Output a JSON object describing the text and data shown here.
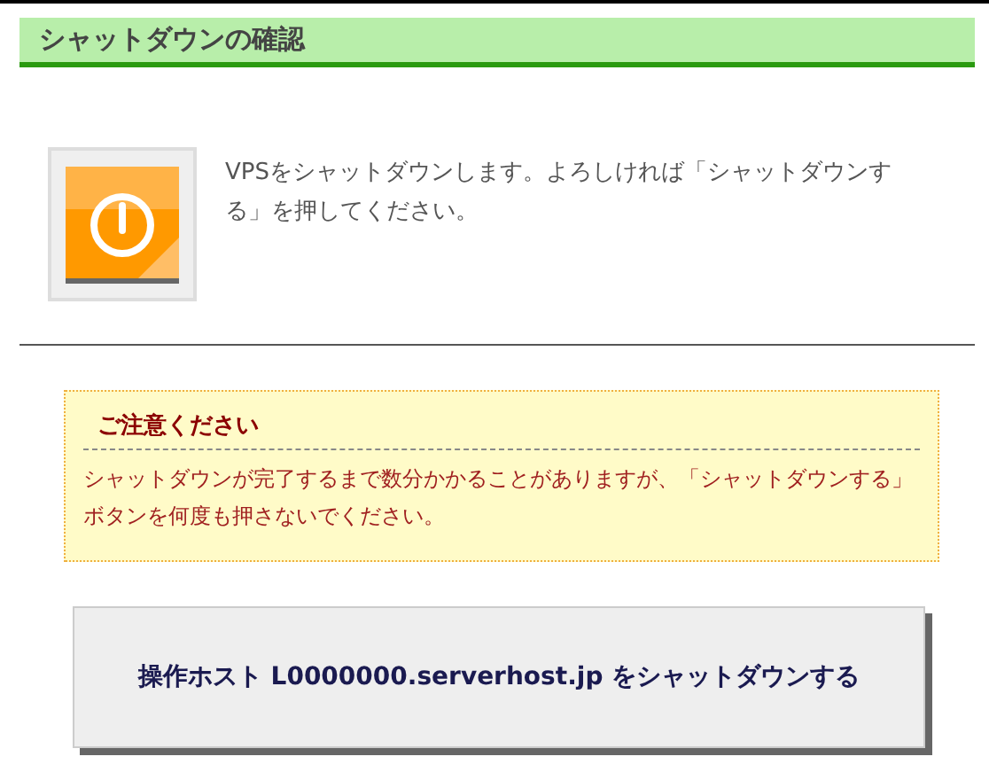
{
  "heading": "シャットダウンの確認",
  "message": "VPSをシャットダウンします。よろしければ「シャットダウンする」を押してください。",
  "notice": {
    "title": "ご注意ください",
    "text": "シャットダウンが完了するまで数分かかることがありますが、「シャットダウンする」ボタンを何度も押さないでください。"
  },
  "button": "操作ホスト L0000000.serverhost.jp をシャットダウンする"
}
